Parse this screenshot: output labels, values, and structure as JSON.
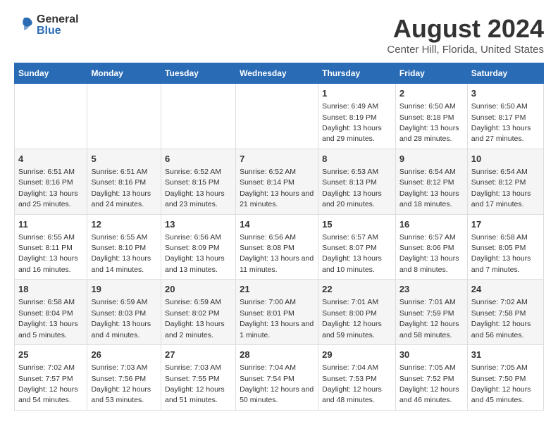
{
  "header": {
    "logo_general": "General",
    "logo_blue": "Blue",
    "title": "August 2024",
    "subtitle": "Center Hill, Florida, United States"
  },
  "days_of_week": [
    "Sunday",
    "Monday",
    "Tuesday",
    "Wednesday",
    "Thursday",
    "Friday",
    "Saturday"
  ],
  "weeks": [
    [
      {
        "day": "",
        "sunrise": "",
        "sunset": "",
        "daylight": ""
      },
      {
        "day": "",
        "sunrise": "",
        "sunset": "",
        "daylight": ""
      },
      {
        "day": "",
        "sunrise": "",
        "sunset": "",
        "daylight": ""
      },
      {
        "day": "",
        "sunrise": "",
        "sunset": "",
        "daylight": ""
      },
      {
        "day": "1",
        "sunrise": "6:49 AM",
        "sunset": "8:19 PM",
        "daylight": "13 hours and 29 minutes."
      },
      {
        "day": "2",
        "sunrise": "6:50 AM",
        "sunset": "8:18 PM",
        "daylight": "13 hours and 28 minutes."
      },
      {
        "day": "3",
        "sunrise": "6:50 AM",
        "sunset": "8:17 PM",
        "daylight": "13 hours and 27 minutes."
      }
    ],
    [
      {
        "day": "4",
        "sunrise": "6:51 AM",
        "sunset": "8:16 PM",
        "daylight": "13 hours and 25 minutes."
      },
      {
        "day": "5",
        "sunrise": "6:51 AM",
        "sunset": "8:16 PM",
        "daylight": "13 hours and 24 minutes."
      },
      {
        "day": "6",
        "sunrise": "6:52 AM",
        "sunset": "8:15 PM",
        "daylight": "13 hours and 23 minutes."
      },
      {
        "day": "7",
        "sunrise": "6:52 AM",
        "sunset": "8:14 PM",
        "daylight": "13 hours and 21 minutes."
      },
      {
        "day": "8",
        "sunrise": "6:53 AM",
        "sunset": "8:13 PM",
        "daylight": "13 hours and 20 minutes."
      },
      {
        "day": "9",
        "sunrise": "6:54 AM",
        "sunset": "8:12 PM",
        "daylight": "13 hours and 18 minutes."
      },
      {
        "day": "10",
        "sunrise": "6:54 AM",
        "sunset": "8:12 PM",
        "daylight": "13 hours and 17 minutes."
      }
    ],
    [
      {
        "day": "11",
        "sunrise": "6:55 AM",
        "sunset": "8:11 PM",
        "daylight": "13 hours and 16 minutes."
      },
      {
        "day": "12",
        "sunrise": "6:55 AM",
        "sunset": "8:10 PM",
        "daylight": "13 hours and 14 minutes."
      },
      {
        "day": "13",
        "sunrise": "6:56 AM",
        "sunset": "8:09 PM",
        "daylight": "13 hours and 13 minutes."
      },
      {
        "day": "14",
        "sunrise": "6:56 AM",
        "sunset": "8:08 PM",
        "daylight": "13 hours and 11 minutes."
      },
      {
        "day": "15",
        "sunrise": "6:57 AM",
        "sunset": "8:07 PM",
        "daylight": "13 hours and 10 minutes."
      },
      {
        "day": "16",
        "sunrise": "6:57 AM",
        "sunset": "8:06 PM",
        "daylight": "13 hours and 8 minutes."
      },
      {
        "day": "17",
        "sunrise": "6:58 AM",
        "sunset": "8:05 PM",
        "daylight": "13 hours and 7 minutes."
      }
    ],
    [
      {
        "day": "18",
        "sunrise": "6:58 AM",
        "sunset": "8:04 PM",
        "daylight": "13 hours and 5 minutes."
      },
      {
        "day": "19",
        "sunrise": "6:59 AM",
        "sunset": "8:03 PM",
        "daylight": "13 hours and 4 minutes."
      },
      {
        "day": "20",
        "sunrise": "6:59 AM",
        "sunset": "8:02 PM",
        "daylight": "13 hours and 2 minutes."
      },
      {
        "day": "21",
        "sunrise": "7:00 AM",
        "sunset": "8:01 PM",
        "daylight": "13 hours and 1 minute."
      },
      {
        "day": "22",
        "sunrise": "7:01 AM",
        "sunset": "8:00 PM",
        "daylight": "12 hours and 59 minutes."
      },
      {
        "day": "23",
        "sunrise": "7:01 AM",
        "sunset": "7:59 PM",
        "daylight": "12 hours and 58 minutes."
      },
      {
        "day": "24",
        "sunrise": "7:02 AM",
        "sunset": "7:58 PM",
        "daylight": "12 hours and 56 minutes."
      }
    ],
    [
      {
        "day": "25",
        "sunrise": "7:02 AM",
        "sunset": "7:57 PM",
        "daylight": "12 hours and 54 minutes."
      },
      {
        "day": "26",
        "sunrise": "7:03 AM",
        "sunset": "7:56 PM",
        "daylight": "12 hours and 53 minutes."
      },
      {
        "day": "27",
        "sunrise": "7:03 AM",
        "sunset": "7:55 PM",
        "daylight": "12 hours and 51 minutes."
      },
      {
        "day": "28",
        "sunrise": "7:04 AM",
        "sunset": "7:54 PM",
        "daylight": "12 hours and 50 minutes."
      },
      {
        "day": "29",
        "sunrise": "7:04 AM",
        "sunset": "7:53 PM",
        "daylight": "12 hours and 48 minutes."
      },
      {
        "day": "30",
        "sunrise": "7:05 AM",
        "sunset": "7:52 PM",
        "daylight": "12 hours and 46 minutes."
      },
      {
        "day": "31",
        "sunrise": "7:05 AM",
        "sunset": "7:50 PM",
        "daylight": "12 hours and 45 minutes."
      }
    ]
  ],
  "labels": {
    "sunrise": "Sunrise:",
    "sunset": "Sunset:",
    "daylight": "Daylight:"
  }
}
